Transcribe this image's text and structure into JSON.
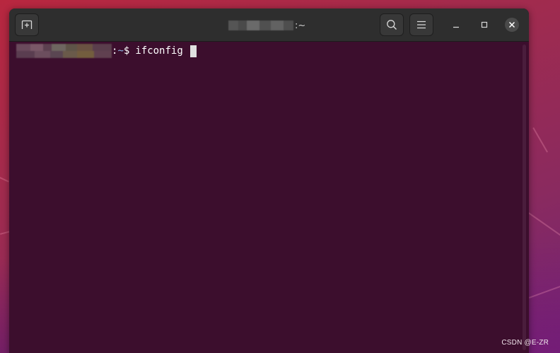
{
  "window": {
    "title_suffix": ":~",
    "buttons": {
      "new_tab": "new-tab-icon",
      "search": "search-icon",
      "menu": "hamburger-menu-icon",
      "minimize": "minimize-icon",
      "maximize": "maximize-icon",
      "close": "close-icon"
    }
  },
  "terminal": {
    "prompt_separator": ":",
    "prompt_path": "~",
    "prompt_symbol": "$",
    "command": "ifconfig"
  },
  "watermark": "CSDN @E-ZR",
  "colors": {
    "terminal_bg": "#3c0e2d",
    "headerbar_bg": "#2e2e2e",
    "prompt_path": "#8fb4e6",
    "text": "#ffffff"
  }
}
